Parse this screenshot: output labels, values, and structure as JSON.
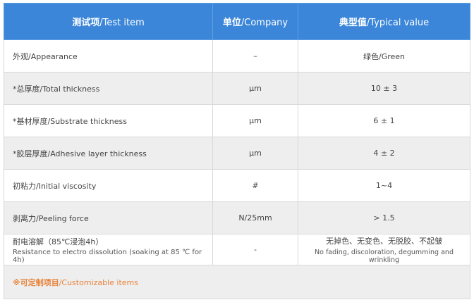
{
  "header": {
    "col1_cn": "测试项",
    "col1_en": "/Test item",
    "col2_cn": "单位",
    "col2_en": "/Company",
    "col3_cn": "典型值",
    "col3_en": "/Typical value"
  },
  "rows": [
    {
      "item": "外观/Appearance",
      "unit": "–",
      "value": "绿色/Green"
    },
    {
      "item": "*总厚度/Total thickness",
      "unit": "µm",
      "value": "10 ± 3"
    },
    {
      "item": "*基材厚度/Substrate thickness",
      "unit": "µm",
      "value": "6 ± 1"
    },
    {
      "item": "*胶层厚度/Adhesive layer thickness",
      "unit": "µm",
      "value": "4 ± 2"
    },
    {
      "item": "初粘力/Initial viscosity",
      "unit": "#",
      "value": "1~4"
    },
    {
      "item": "剥离力/Peeling force",
      "unit": "N/25mm",
      "value": "> 1.5"
    },
    {
      "item": "耐电溶解（85℃浸泡4h）",
      "item_en": "Resistance to electro dissolution (soaking at 85 ℃ for 4h)",
      "unit": "-",
      "value": "无掉色、无变色、无脱胶、不起皱",
      "value_en": "No fading, discoloration, degumming and wrinkling"
    }
  ],
  "footer": {
    "cn": "※可定制项目",
    "en": "/Customizable items"
  },
  "colors": {
    "header_bg": "#3b86d9",
    "footer_text": "#e9823a"
  }
}
